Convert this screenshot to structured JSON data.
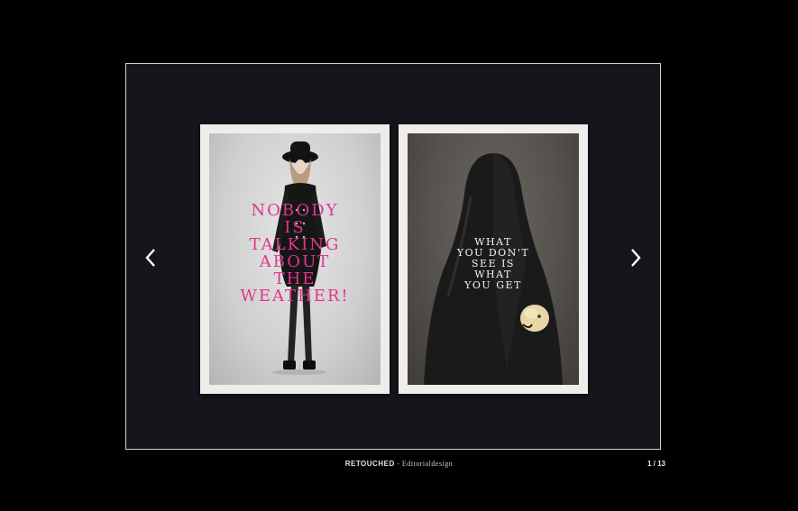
{
  "gallery": {
    "prev_icon": "chevron-left-icon",
    "next_icon": "chevron-right-icon",
    "posters": {
      "left": {
        "headline_lines": [
          "NOBODY",
          "IS",
          "TALKING",
          "ABOUT",
          "THE",
          "WEATHER!"
        ],
        "accent_color": "#e2358f"
      },
      "right": {
        "headline_lines": [
          "WHAT",
          "YOU DON'T",
          "SEE IS",
          "WHAT",
          "YOU GET"
        ],
        "text_color": "#f3f3f3"
      }
    }
  },
  "caption": {
    "title": "RETOUCHED",
    "separator": " - ",
    "subtitle": "Editorialdesign"
  },
  "counter": {
    "text": "1 / 13"
  }
}
